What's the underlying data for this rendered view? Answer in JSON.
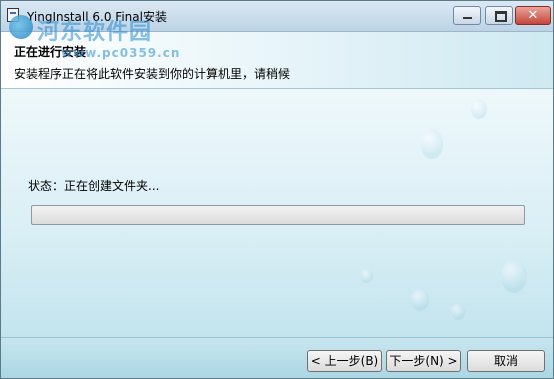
{
  "window": {
    "title": "YingInstall 6.0 Final安装"
  },
  "header": {
    "title": "正在进行安装",
    "subtitle": "安装程序正在将此软件安装到你的计算机里，请稍候"
  },
  "watermark": {
    "main": "河东软件园",
    "url": "www.pc0359.cn"
  },
  "body": {
    "status_text": "状态：正在创建文件夹..."
  },
  "progress": {
    "value_percent": 0
  },
  "buttons": {
    "back": "< 上一步(B)",
    "next": "下一步(N) >",
    "cancel": "取消"
  },
  "icons": [
    "app-icon",
    "minimize-icon",
    "maximize-icon",
    "close-icon"
  ]
}
